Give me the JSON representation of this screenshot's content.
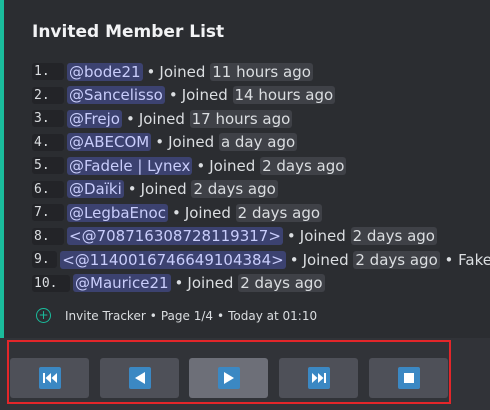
{
  "embed": {
    "title": "Invited Member List",
    "accent_color": "#1abc9c",
    "rows": [
      {
        "num": "1.",
        "mention": "@bode21",
        "sep": "•",
        "joined": "Joined",
        "time": "11 hours ago",
        "extra": ""
      },
      {
        "num": "2.",
        "mention": "@Sancelisso",
        "sep": "•",
        "joined": "Joined",
        "time": "14 hours ago",
        "extra": ""
      },
      {
        "num": "3.",
        "mention": "@Frejo",
        "sep": "•",
        "joined": "Joined",
        "time": "17 hours ago",
        "extra": ""
      },
      {
        "num": "4.",
        "mention": "@ABECOM",
        "sep": "•",
        "joined": "Joined",
        "time": "a day ago",
        "extra": ""
      },
      {
        "num": "5.",
        "mention": "@Fadele | Lynex",
        "sep": "•",
        "joined": "Joined",
        "time": "2 days ago",
        "extra": ""
      },
      {
        "num": "6.",
        "mention": "@Daïki",
        "sep": "•",
        "joined": "Joined",
        "time": "2 days ago",
        "extra": ""
      },
      {
        "num": "7.",
        "mention": "@LegbaEnoc",
        "sep": "•",
        "joined": "Joined",
        "time": "2 days ago",
        "extra": ""
      },
      {
        "num": "8.",
        "mention": "<@708716308728119317>",
        "sep": "•",
        "joined": "Joined",
        "time": "2 days ago",
        "extra": ""
      },
      {
        "num": "9.",
        "mention": "<@1140016746649104384>",
        "sep": "•",
        "joined": "Joined",
        "time": "2 days ago",
        "extra": "• Fake"
      },
      {
        "num": "10.",
        "mention": "@Maurice21",
        "sep": "•",
        "joined": "Joined",
        "time": "2 days ago",
        "extra": ""
      }
    ],
    "footer": {
      "icon": "plus-circle-icon",
      "bot": "Invite Tracker",
      "page": "Page 1/4",
      "time": "Today at 01:10",
      "sep": "•"
    }
  },
  "controls": {
    "buttons": [
      {
        "name": "first-page-button",
        "icon": "skip-to-start-icon",
        "active": false
      },
      {
        "name": "previous-page-button",
        "icon": "previous-arrow-icon",
        "active": false
      },
      {
        "name": "next-page-button",
        "icon": "next-arrow-icon",
        "active": true
      },
      {
        "name": "last-page-button",
        "icon": "skip-to-end-icon",
        "active": false
      },
      {
        "name": "stop-button",
        "icon": "stop-icon",
        "active": false
      }
    ],
    "button_color": "#3b88c3",
    "highlight_color": "#e3262a"
  }
}
